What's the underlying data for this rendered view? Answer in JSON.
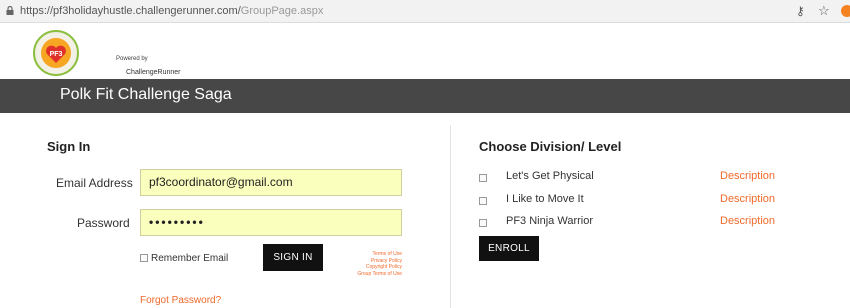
{
  "browser": {
    "url_host": "https://pf3holidayhustle.challengerunner.com/",
    "url_path": "GroupPage.aspx"
  },
  "header": {
    "logo_text": "PF3",
    "logo_ring_text": "Polk Fit, Fresh and Friendly",
    "powered_by": "Powered by",
    "brand": "ChallengeRunner",
    "title": "Polk Fit Challenge Saga"
  },
  "signin": {
    "heading": "Sign In",
    "email_label": "Email Address",
    "email_value": "pf3coordinator@gmail.com",
    "password_label": "Password",
    "password_value": "•••••••••",
    "remember_label": "Remember Email",
    "signin_button": "SIGN IN",
    "legal_links": [
      "Terms of Use",
      "Privacy Policy",
      "Copyright Policy",
      "Group Terms of Use"
    ],
    "forgot": "Forgot Password?"
  },
  "division": {
    "heading": "Choose Division/ Level",
    "items": [
      {
        "name": "Let's Get Physical",
        "link": "Description"
      },
      {
        "name": "I Like to Move It",
        "link": "Description"
      },
      {
        "name": "PF3 Ninja Warrior",
        "link": "Description"
      }
    ],
    "enroll_button": "ENROLL"
  },
  "colors": {
    "accent": "#f06a2b",
    "titlebar": "#474747",
    "autofill": "#faffbd"
  }
}
